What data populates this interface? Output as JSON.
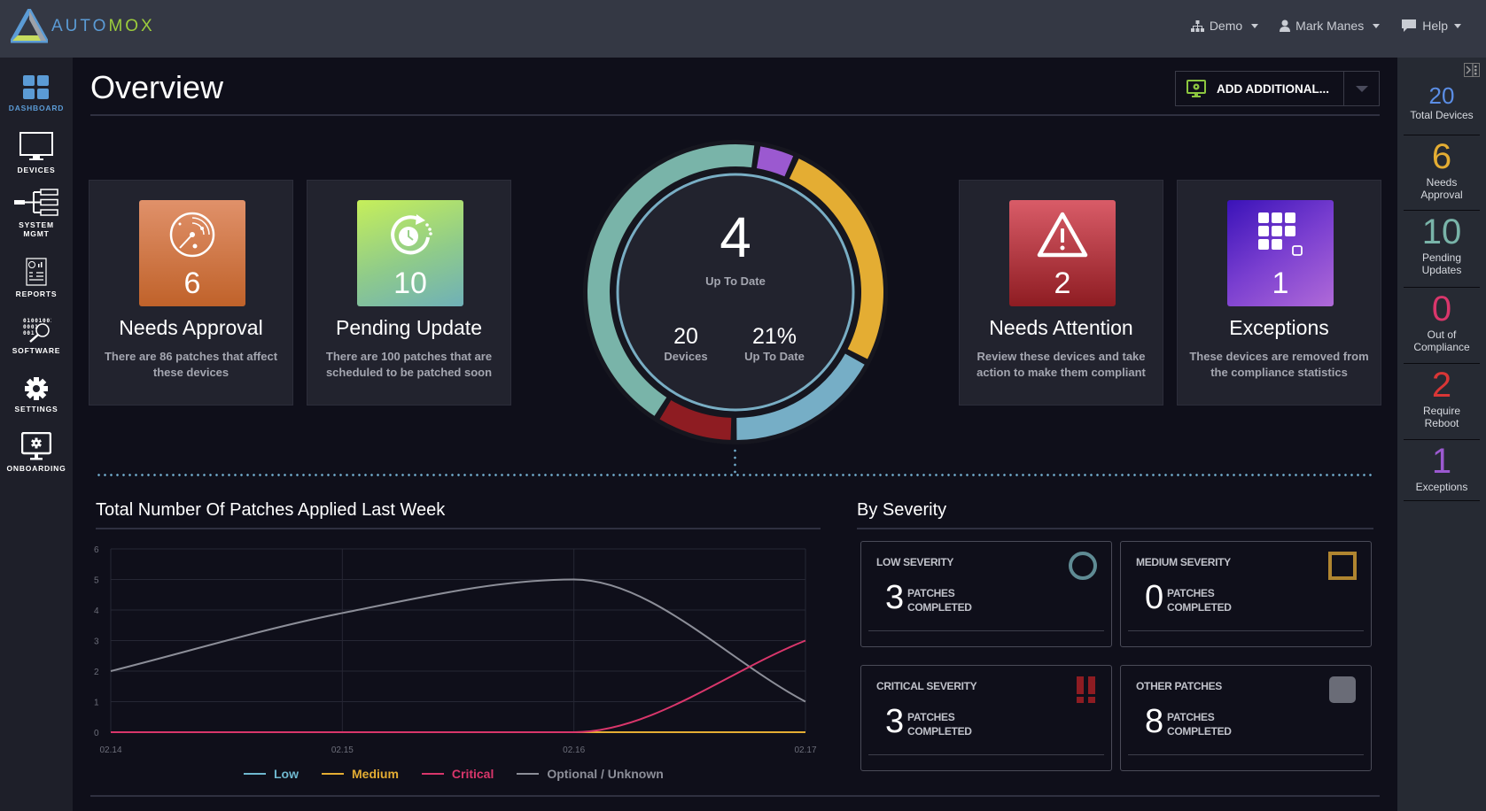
{
  "app": {
    "logo_part1": "AUTO",
    "logo_part2": "MOX"
  },
  "topnav": {
    "org": "Demo",
    "user": "Mark Manes",
    "help": "Help"
  },
  "sidebar": {
    "items": [
      {
        "label": "DASHBOARD",
        "icon": "dashboard-icon",
        "active": true
      },
      {
        "label": "DEVICES",
        "icon": "monitor-icon"
      },
      {
        "label_line1": "SYSTEM",
        "label_line2": "MGMT",
        "icon": "system-tree-icon"
      },
      {
        "label": "REPORTS",
        "icon": "report-icon"
      },
      {
        "label": "SOFTWARE",
        "icon": "software-icon",
        "binary_text": [
          "01001001",
          "0001",
          "001"
        ]
      },
      {
        "label": "SETTINGS",
        "icon": "gear-icon"
      },
      {
        "label": "ONBOARDING",
        "icon": "onboarding-icon"
      }
    ]
  },
  "page": {
    "title": "Overview",
    "add_button_label": "ADD ADDITIONAL..."
  },
  "cards": [
    {
      "count": "6",
      "title": "Needs Approval",
      "desc": "There are 86 patches that affect these devices",
      "icon": "radar-icon"
    },
    {
      "count": "10",
      "title": "Pending Update",
      "desc": "There are 100 patches that are scheduled to be patched soon",
      "icon": "clock-refresh-icon"
    },
    {
      "count": "2",
      "title": "Needs Attention",
      "desc": "Review these devices and take action to make them compliant",
      "icon": "warning-icon"
    },
    {
      "count": "1",
      "title": "Exceptions",
      "desc": "These devices are removed from the compliance statistics",
      "icon": "grid-exception-icon"
    }
  ],
  "donut": {
    "center_value": "4",
    "center_label": "Up To Date",
    "devices_value": "20",
    "devices_label": "Devices",
    "percent_value": "21%",
    "percent_label": "Up To Date",
    "segments": [
      {
        "name": "Pending Updates",
        "value": 10,
        "color": "#79b4a9"
      },
      {
        "name": "Exceptions",
        "value": 1,
        "color": "#9b59d0"
      },
      {
        "name": "Needs Approval",
        "value": 6,
        "color": "#e4ad33"
      },
      {
        "name": "Up To Date",
        "value": 4,
        "color": "#76aec6"
      },
      {
        "name": "Needs Attention",
        "value": 2,
        "color": "#8e1c22"
      }
    ]
  },
  "right_stats": [
    {
      "value": "20",
      "label": "Total Devices",
      "color": "#5b8ee6"
    },
    {
      "value": "6",
      "label": "Needs Approval",
      "color": "#e4ad33"
    },
    {
      "value": "10",
      "label": "Pending Updates",
      "color": "#79b4a9"
    },
    {
      "value": "0",
      "label": "Out of Compliance",
      "color": "#d9366b"
    },
    {
      "value": "2",
      "label": "Require Reboot",
      "color": "#d93636"
    },
    {
      "value": "1",
      "label": "Exceptions",
      "color": "#9b59d0"
    }
  ],
  "patches_section": {
    "title": "Total Number Of Patches Applied Last Week"
  },
  "chart_data": {
    "type": "line",
    "title": "Total Number Of Patches Applied Last Week",
    "xlabel": "",
    "ylabel": "",
    "x": [
      "02.14",
      "02.15",
      "02.16",
      "02.17"
    ],
    "ylim": [
      0,
      6
    ],
    "yticks": [
      0,
      1,
      2,
      3,
      4,
      5,
      6
    ],
    "grid": true,
    "legend_position": "bottom",
    "series": [
      {
        "name": "Low",
        "values": [
          0,
          0,
          0,
          0
        ],
        "color": "#6fb8cf"
      },
      {
        "name": "Medium",
        "values": [
          0,
          0,
          0,
          0
        ],
        "color": "#e4ad33"
      },
      {
        "name": "Critical",
        "values": [
          0,
          0,
          0,
          3
        ],
        "color": "#d9366b"
      },
      {
        "name": "Optional / Unknown",
        "values": [
          2,
          3.9,
          5,
          1
        ],
        "color": "#8c8e98"
      }
    ]
  },
  "severity_section": {
    "title": "By Severity",
    "cards": [
      {
        "title": "LOW SEVERITY",
        "count": "3",
        "unit_line1": "PATCHES",
        "unit_line2": "COMPLETED",
        "icon": "circle-icon"
      },
      {
        "title": "MEDIUM SEVERITY",
        "count": "0",
        "unit_line1": "PATCHES",
        "unit_line2": "COMPLETED",
        "icon": "square-outline-icon"
      },
      {
        "title": "CRITICAL SEVERITY",
        "count": "3",
        "unit_line1": "PATCHES",
        "unit_line2": "COMPLETED",
        "icon": "double-exclamation-icon"
      },
      {
        "title": "OTHER PATCHES",
        "count": "8",
        "unit_line1": "PATCHES",
        "unit_line2": "COMPLETED",
        "icon": "filled-square-icon"
      }
    ]
  }
}
